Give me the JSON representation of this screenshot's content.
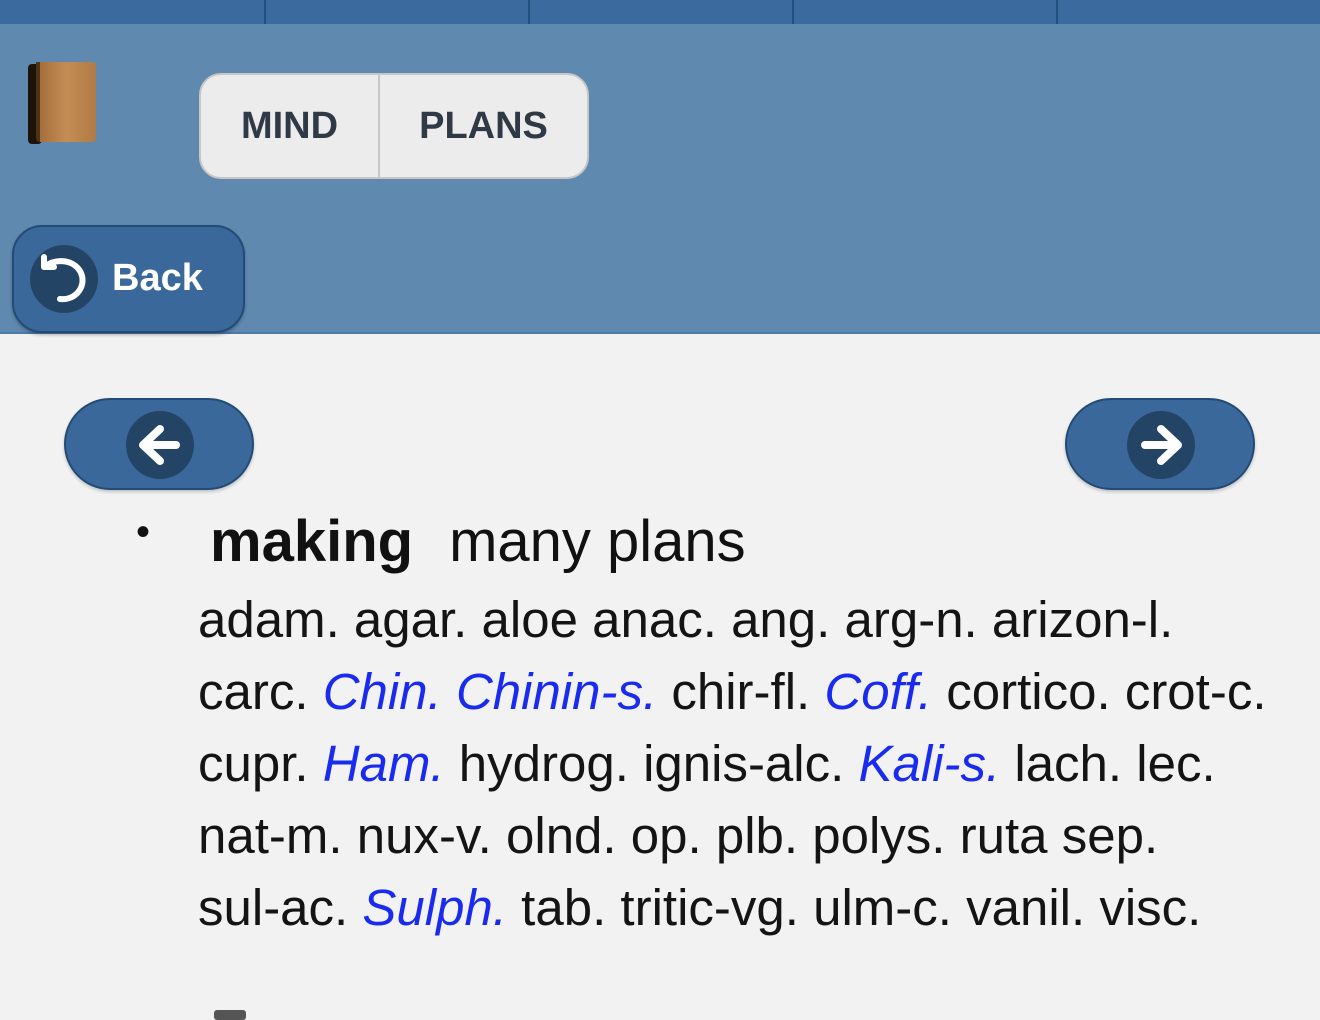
{
  "header": {
    "segment_buttons": [
      "MIND",
      "PLANS"
    ],
    "back_label": "Back"
  },
  "entry": {
    "bullet": "•",
    "keyword": "making",
    "rubric_rest": "many plans",
    "remedies": [
      {
        "text": "adam.",
        "emphasis": false
      },
      {
        "text": "agar.",
        "emphasis": false
      },
      {
        "text": "aloe",
        "emphasis": false
      },
      {
        "text": "anac.",
        "emphasis": false
      },
      {
        "text": "ang.",
        "emphasis": false
      },
      {
        "text": "arg-n.",
        "emphasis": false
      },
      {
        "text": "arizon-l.",
        "emphasis": false
      },
      {
        "text": "carc.",
        "emphasis": false
      },
      {
        "text": "Chin.",
        "emphasis": true
      },
      {
        "text": "Chinin-s.",
        "emphasis": true
      },
      {
        "text": "chir-fl.",
        "emphasis": false
      },
      {
        "text": "Coff.",
        "emphasis": true
      },
      {
        "text": "cortico.",
        "emphasis": false
      },
      {
        "text": "crot-c.",
        "emphasis": false
      },
      {
        "text": "cupr.",
        "emphasis": false
      },
      {
        "text": "Ham.",
        "emphasis": true
      },
      {
        "text": "hydrog.",
        "emphasis": false
      },
      {
        "text": "ignis-alc.",
        "emphasis": false
      },
      {
        "text": "Kali-s.",
        "emphasis": true
      },
      {
        "text": "lach.",
        "emphasis": false
      },
      {
        "text": "lec.",
        "emphasis": false
      },
      {
        "text": "nat-m.",
        "emphasis": false
      },
      {
        "text": "nux-v.",
        "emphasis": false
      },
      {
        "text": "olnd.",
        "emphasis": false
      },
      {
        "text": "op.",
        "emphasis": false
      },
      {
        "text": "plb.",
        "emphasis": false
      },
      {
        "text": "polys.",
        "emphasis": false
      },
      {
        "text": "ruta",
        "emphasis": false
      },
      {
        "text": "sep.",
        "emphasis": false
      },
      {
        "text": "sul-ac.",
        "emphasis": false
      },
      {
        "text": "Sulph.",
        "emphasis": true
      },
      {
        "text": "tab.",
        "emphasis": false
      },
      {
        "text": "tritic-vg.",
        "emphasis": false
      },
      {
        "text": "ulm-c.",
        "emphasis": false
      },
      {
        "text": "vanil.",
        "emphasis": false
      },
      {
        "text": "visc.",
        "emphasis": false
      }
    ]
  },
  "colors": {
    "header_bg": "#6089b0",
    "button_bg": "#3b689a",
    "emphasis_remedy": "#1a2bf0"
  },
  "icons": {
    "book": "book-icon",
    "back": "undo-arrow-icon",
    "prev": "arrow-left-icon",
    "next": "arrow-right-icon"
  }
}
